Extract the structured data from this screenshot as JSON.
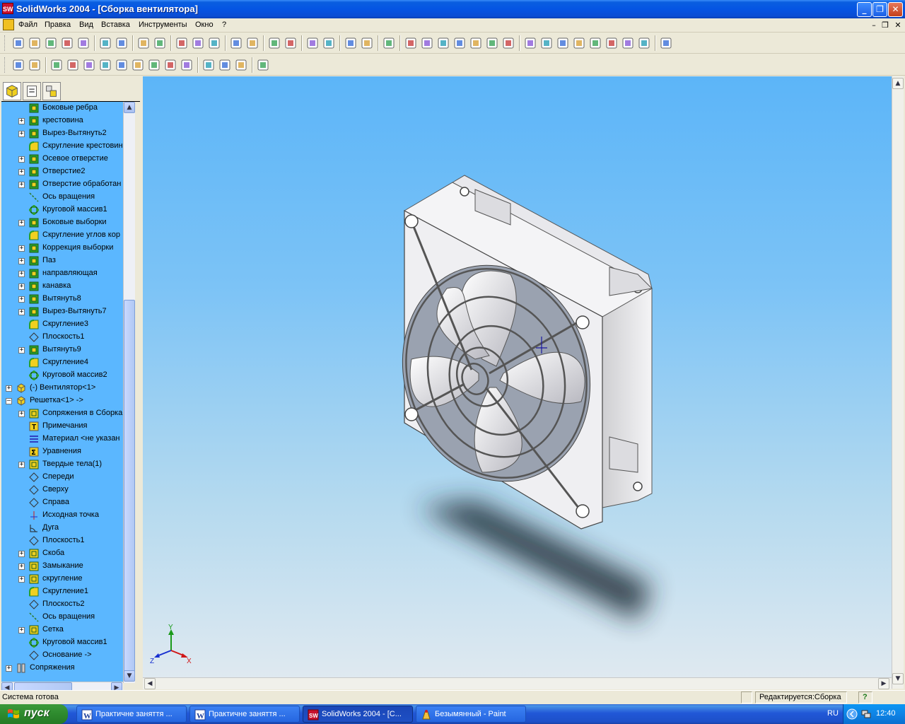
{
  "window": {
    "title": "SolidWorks 2004 - [Сборка вентилятора]",
    "app_icon_text": "SW",
    "minimize_icon": "_",
    "restore_icon": "❐",
    "close_icon": "✕"
  },
  "menu": {
    "items": [
      "Файл",
      "Правка",
      "Вид",
      "Вставка",
      "Инструменты",
      "Окно",
      "?"
    ],
    "mdi_minimize": "–",
    "mdi_restore": "❐",
    "mdi_close": "✕"
  },
  "toolbar1": {
    "buttons": [
      "new-icon",
      "open-icon",
      "save-icon",
      "print-drawing-icon",
      "make-assembly-icon",
      "print-icon",
      "print-preview-icon",
      "undo-icon",
      "redo-icon",
      "select-icon",
      "sketch-icon",
      "traffic-light-icon",
      "grid-icon",
      "grid2-icon",
      "filter-icon",
      "filter2-icon",
      "help-icon",
      "whats-this-icon",
      "rebuild-icon",
      "options-icon",
      "pin-icon",
      "zoom-fit-icon",
      "zoom-in-icon",
      "zoom-area-icon",
      "zoom-out-icon",
      "rotate-icon",
      "pan-icon",
      "view-orient-icon",
      "wireframe-icon",
      "hidden-lines-icon",
      "hidden-removed-icon",
      "shaded-edges-icon",
      "shaded-icon",
      "perspective-icon",
      "section-icon",
      "shadow-icon",
      "realview-icon"
    ]
  },
  "toolbar2": {
    "buttons": [
      "assembly-component-icon",
      "sketch-mode-icon",
      "insert-component-icon",
      "hide-show-icon",
      "change-transparency-icon",
      "suppress-icon",
      "mate-icon",
      "move-component-icon",
      "rotate-component-icon",
      "smart-fasteners-icon",
      "exploded-view-icon",
      "interference-icon",
      "explode-line-icon",
      "edit-component-icon",
      "assembly-features-icon"
    ]
  },
  "tree": {
    "items": [
      {
        "label": "Боковые ребра",
        "expand": "",
        "icon": "extrude-icon",
        "level": 2
      },
      {
        "label": "крестовина",
        "expand": "+",
        "icon": "extrude-icon",
        "level": 2
      },
      {
        "label": "Вырез-Вытянуть2",
        "expand": "+",
        "icon": "cut-extrude-icon",
        "level": 2
      },
      {
        "label": "Скругление крестовин",
        "expand": "",
        "icon": "fillet-icon",
        "level": 2
      },
      {
        "label": "Осевое отверстие",
        "expand": "+",
        "icon": "hole-icon",
        "level": 2
      },
      {
        "label": "Отверстие2",
        "expand": "+",
        "icon": "hole-icon",
        "level": 2
      },
      {
        "label": "Отверстие обработан",
        "expand": "+",
        "icon": "hole-wizard-icon",
        "level": 2
      },
      {
        "label": "Ось вращения",
        "expand": "",
        "icon": "axis-icon",
        "level": 2
      },
      {
        "label": "Круговой массив1",
        "expand": "",
        "icon": "circular-pattern-icon",
        "level": 2
      },
      {
        "label": "Боковые выборки",
        "expand": "+",
        "icon": "cut-extrude-icon",
        "level": 2
      },
      {
        "label": "Скругление углов кор",
        "expand": "",
        "icon": "fillet-icon",
        "level": 2
      },
      {
        "label": "Коррекция выборки",
        "expand": "+",
        "icon": "cut-extrude-icon",
        "level": 2
      },
      {
        "label": "Паз",
        "expand": "+",
        "icon": "cut-extrude-icon",
        "level": 2
      },
      {
        "label": "направляющая",
        "expand": "+",
        "icon": "extrude-icon",
        "level": 2
      },
      {
        "label": "канавка",
        "expand": "+",
        "icon": "cut-extrude-icon",
        "level": 2
      },
      {
        "label": "Вытянуть8",
        "expand": "+",
        "icon": "extrude-icon",
        "level": 2
      },
      {
        "label": "Вырез-Вытянуть7",
        "expand": "+",
        "icon": "cut-extrude-icon",
        "level": 2
      },
      {
        "label": "Скругление3",
        "expand": "",
        "icon": "fillet-icon",
        "level": 2
      },
      {
        "label": "Плоскость1",
        "expand": "",
        "icon": "plane-icon",
        "level": 2
      },
      {
        "label": "Вытянуть9",
        "expand": "+",
        "icon": "extrude-icon",
        "level": 2
      },
      {
        "label": "Скругление4",
        "expand": "",
        "icon": "fillet-icon",
        "level": 2
      },
      {
        "label": "Круговой массив2",
        "expand": "",
        "icon": "circular-pattern-icon",
        "level": 2
      },
      {
        "label": "(-) Вентилятор<1>",
        "expand": "+",
        "icon": "part-icon",
        "level": 1
      },
      {
        "label": "Решетка<1> ->",
        "expand": "–",
        "icon": "part-icon",
        "level": 1
      },
      {
        "label": "Сопряжения в Сборка",
        "expand": "+",
        "icon": "mates-folder-icon",
        "level": 2
      },
      {
        "label": "Примечания",
        "expand": "",
        "icon": "annotations-icon",
        "level": 2
      },
      {
        "label": "Материал <не указан",
        "expand": "",
        "icon": "material-icon",
        "level": 2
      },
      {
        "label": "Уравнения",
        "expand": "",
        "icon": "equations-icon",
        "level": 2
      },
      {
        "label": "Твердые тела(1)",
        "expand": "+",
        "icon": "solid-bodies-icon",
        "level": 2
      },
      {
        "label": "Спереди",
        "expand": "",
        "icon": "plane-icon",
        "level": 2
      },
      {
        "label": "Сверху",
        "expand": "",
        "icon": "plane-icon",
        "level": 2
      },
      {
        "label": "Справа",
        "expand": "",
        "icon": "plane-icon",
        "level": 2
      },
      {
        "label": "Исходная точка",
        "expand": "",
        "icon": "origin-icon",
        "level": 2
      },
      {
        "label": "Дуга",
        "expand": "",
        "icon": "sketch-icon",
        "level": 2
      },
      {
        "label": "Плоскость1",
        "expand": "",
        "icon": "plane-icon",
        "level": 2
      },
      {
        "label": "Скоба",
        "expand": "+",
        "icon": "revolve-icon",
        "level": 2
      },
      {
        "label": "Замыкание",
        "expand": "+",
        "icon": "sweep-icon",
        "level": 2
      },
      {
        "label": "скругление",
        "expand": "+",
        "icon": "sweep-icon",
        "level": 2
      },
      {
        "label": "Скругление1",
        "expand": "",
        "icon": "fillet-icon",
        "level": 2
      },
      {
        "label": "Плоскость2",
        "expand": "",
        "icon": "plane-icon",
        "level": 2
      },
      {
        "label": "Ось вращения",
        "expand": "",
        "icon": "axis-icon",
        "level": 2
      },
      {
        "label": "Сетка",
        "expand": "+",
        "icon": "revolve-icon",
        "level": 2
      },
      {
        "label": "Круговой массив1",
        "expand": "",
        "icon": "circular-pattern-icon",
        "level": 2
      },
      {
        "label": "Основание ->",
        "expand": "",
        "icon": "plane-icon",
        "level": 2
      },
      {
        "label": "Сопряжения",
        "expand": "+",
        "icon": "mates-icon",
        "level": 1
      }
    ]
  },
  "triad": {
    "x": "X",
    "y": "Y",
    "z": "Z"
  },
  "status": {
    "left": "Система готова",
    "editing": "Редактируется:Сборка",
    "help": "?"
  },
  "taskbar": {
    "start": "пуск",
    "items": [
      {
        "label": "Практичне заняття ...",
        "icon": "word-icon",
        "active": false
      },
      {
        "label": "Практичне заняття ...",
        "icon": "word-icon",
        "active": false
      },
      {
        "label": "SolidWorks 2004 - [С...",
        "icon": "solidworks-icon",
        "active": true
      },
      {
        "label": "Безымянный - Paint",
        "icon": "paint-icon",
        "active": false
      }
    ],
    "lang": "RU",
    "clock": "12:40"
  },
  "colors": {
    "tree_bg": "#5bb7ff",
    "viewport_top": "#5cb5f8",
    "viewport_bottom": "#dfe9f0",
    "xp_blue": "#0554e3"
  }
}
